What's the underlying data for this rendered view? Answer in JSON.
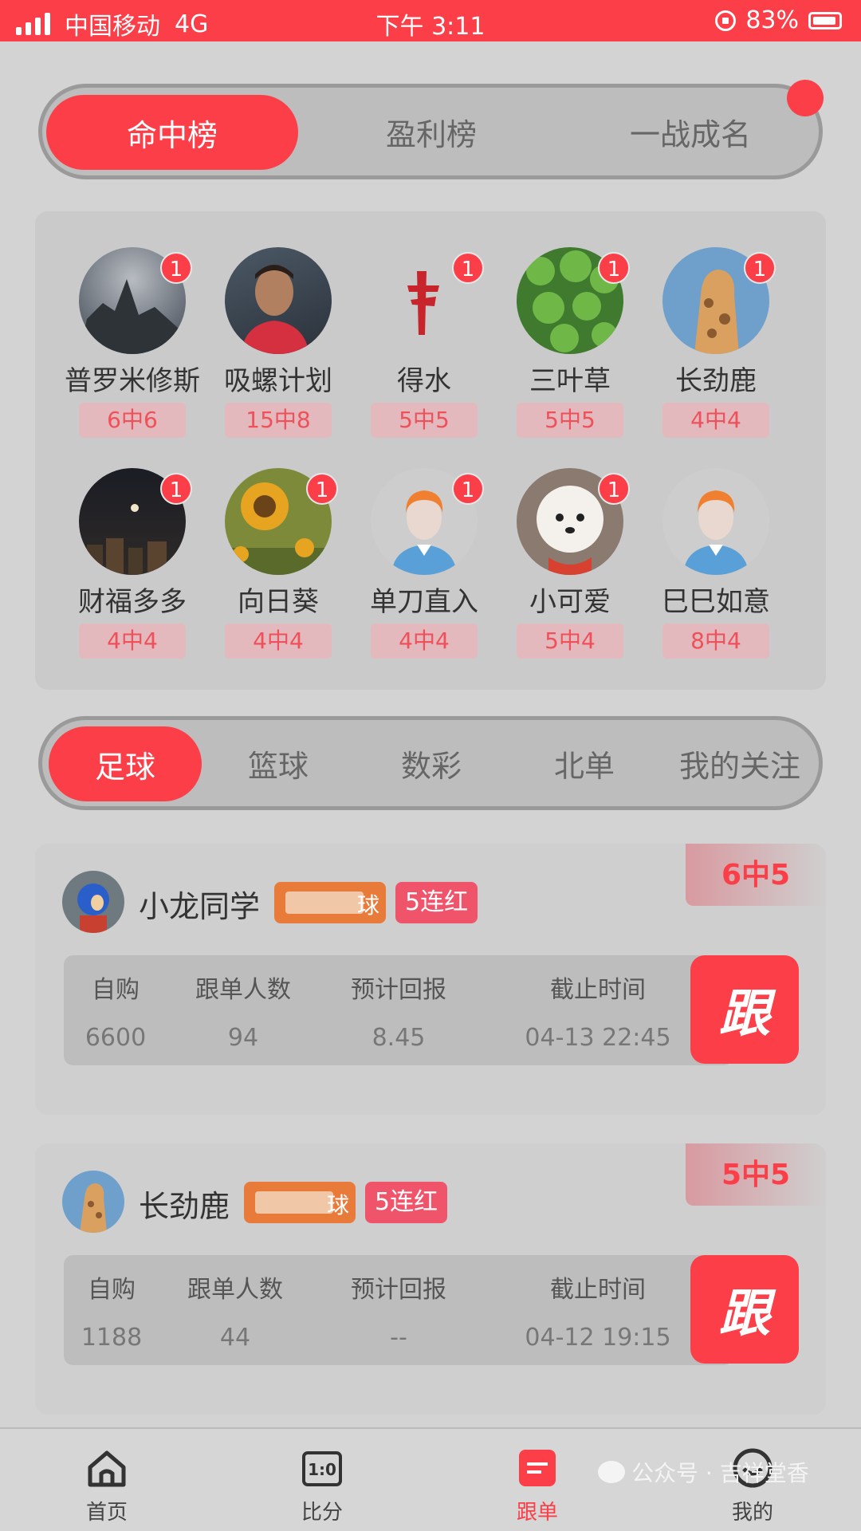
{
  "status_bar": {
    "carrier": "中国移动",
    "network": "4G",
    "time": "下午 3:11",
    "battery": "83%"
  },
  "rank_tabs": [
    {
      "label": "命中榜",
      "active": true
    },
    {
      "label": "盈利榜",
      "active": false
    },
    {
      "label": "一战成名",
      "active": false
    }
  ],
  "leaderboard": [
    {
      "name": "普罗米修斯",
      "record": "6中6",
      "badge": "1",
      "avatar": "rock-landscape"
    },
    {
      "name": "吸螺计划",
      "record": "15中8",
      "badge": "",
      "avatar": "footballer-photo"
    },
    {
      "name": "得水",
      "record": "5中5",
      "badge": "1",
      "avatar": "mahjong-tile"
    },
    {
      "name": "三叶草",
      "record": "5中5",
      "badge": "1",
      "avatar": "clover-leaves"
    },
    {
      "name": "长劲鹿",
      "record": "4中4",
      "badge": "1",
      "avatar": "giraffe"
    },
    {
      "name": "财福多多",
      "record": "4中4",
      "badge": "1",
      "avatar": "night-sky"
    },
    {
      "name": "向日葵",
      "record": "4中4",
      "badge": "1",
      "avatar": "sunflower"
    },
    {
      "name": "单刀直入",
      "record": "4中4",
      "badge": "1",
      "avatar": "default-person"
    },
    {
      "name": "小可爱",
      "record": "5中4",
      "badge": "1",
      "avatar": "puppy"
    },
    {
      "name": "巳巳如意",
      "record": "8中4",
      "badge": "",
      "avatar": "default-person"
    }
  ],
  "sport_tabs": [
    {
      "label": "足球",
      "active": true
    },
    {
      "label": "篮球",
      "active": false
    },
    {
      "label": "数彩",
      "active": false
    },
    {
      "label": "北单",
      "active": false
    },
    {
      "label": "我的关注",
      "active": false
    }
  ],
  "info_headers": {
    "self_buy": "自购",
    "followers": "跟单人数",
    "expected_return": "预计回报",
    "deadline": "截止时间"
  },
  "cards": [
    {
      "name": "小龙同学",
      "chip_tail": "球",
      "streak": "5连红",
      "record": "6中5",
      "self_buy": "6600",
      "followers": "94",
      "expected_return": "8.45",
      "deadline": "04-13 22:45",
      "follow_label": "跟"
    },
    {
      "name": "长劲鹿",
      "chip_tail": "球",
      "streak": "5连红",
      "record": "5中5",
      "self_buy": "1188",
      "followers": "44",
      "expected_return": "--",
      "deadline": "04-12 19:15",
      "follow_label": "跟"
    }
  ],
  "bottom_nav": [
    {
      "label": "首页",
      "icon": "home-icon",
      "active": false
    },
    {
      "label": "比分",
      "icon": "scoreboard-icon",
      "active": false
    },
    {
      "label": "跟单",
      "icon": "follow-order-icon",
      "active": true
    },
    {
      "label": "我的",
      "icon": "profile-icon",
      "active": false
    }
  ],
  "watermark": {
    "text": "公众号 · 吉祥堂香"
  },
  "colors": {
    "accent": "#fb3e47",
    "chip_orange": "#e87a3a",
    "chip_red": "#f0546a",
    "background": "#d3d3d3"
  }
}
